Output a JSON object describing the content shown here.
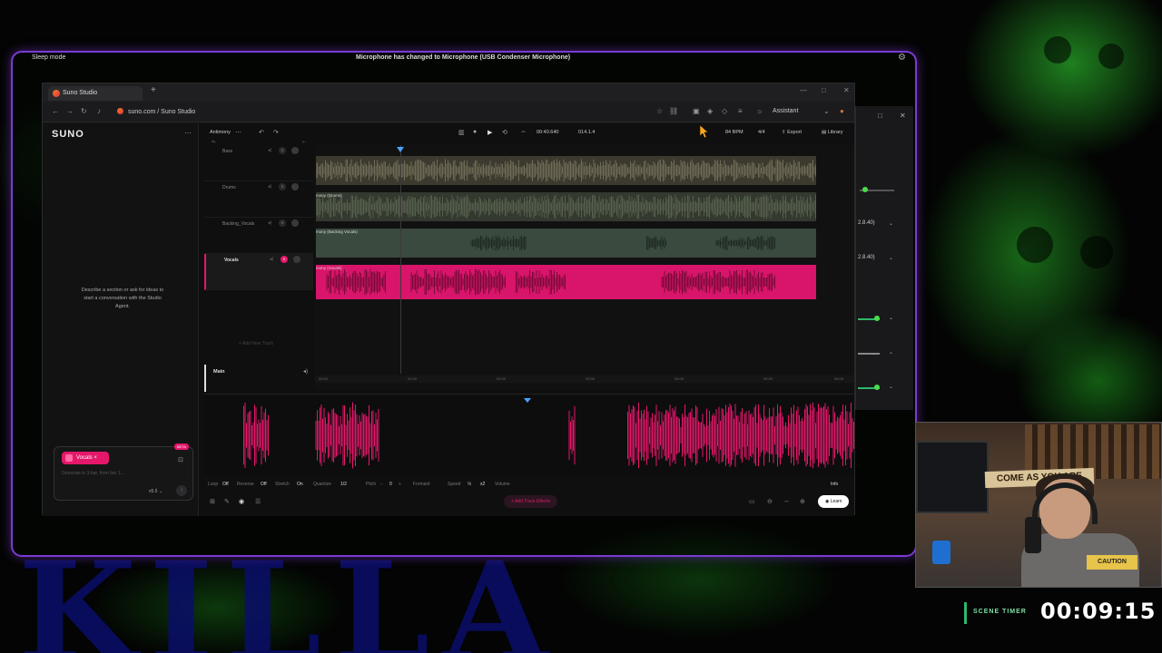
{
  "notifications": {
    "left": "Sleep mode",
    "center": "Microphone has changed to Microphone (USB Condenser Microphone)"
  },
  "background": {
    "brand_text": "KILLA"
  },
  "browser": {
    "tab_title": "Suno Studio",
    "url": "suno.com / Suno Studio",
    "assistant_label": "Assistant"
  },
  "studio": {
    "logo": "SUNO",
    "agent_hint": "Describe a section or ask for ideas to start a conversation with the Studio Agent.",
    "project_name": "Antimony",
    "time_position": "00:40.640",
    "bar_position": "014.1.4",
    "bpm": "84 BPM",
    "signature": "4/4",
    "export_label": "Export",
    "library_label": "Library",
    "tracks": [
      {
        "name": "Bass",
        "clip_label": ""
      },
      {
        "name": "Drums",
        "clip_label": "mony (Drums)"
      },
      {
        "name": "Backing_Vocals",
        "clip_label": "mony (Backing Vocals)"
      },
      {
        "name": "Vocals",
        "clip_label": "mony (Vocals)"
      }
    ],
    "add_track": "Add New Track",
    "main_label": "Main",
    "ruler_ticks": [
      "00:00",
      "01:00",
      "02:00",
      "03:00",
      "04:00",
      "05:00",
      "06:00"
    ],
    "composer": {
      "chip": "Vocals",
      "beta": "BETA",
      "placeholder": "Generate in 3-bar, from bar 1...",
      "model": "v5.5"
    },
    "props": {
      "loop_label": "Loop",
      "loop_value": "Off",
      "reverse_label": "Reverse",
      "reverse_value": "Off",
      "stretch_label": "Stretch",
      "stretch_value": "On",
      "quantize_label": "Quantize",
      "quantize_value": "1/2",
      "pitch_label": "Pitch",
      "pitch_value": "0",
      "formant_label": "Formant",
      "speed_label": "Speed",
      "speed_value": "½",
      "speed_mult": "x2",
      "volume_label": "Volume",
      "info_label": "Info"
    },
    "add_fx": "Add Track Effects",
    "learn": "Learn"
  },
  "obs_panel": {
    "val1": "2.8.40)",
    "val2": "2.8.40)"
  },
  "webcam": {
    "banner": "COME AS YOU ARE",
    "shirt": "CAUTION"
  },
  "scene_timer": {
    "label": "SCENE TIMER",
    "time": "00:09:15"
  },
  "colors": {
    "accent": "#e5176b",
    "frame": "#7a3bd2",
    "timer_green": "#2fb86a"
  }
}
